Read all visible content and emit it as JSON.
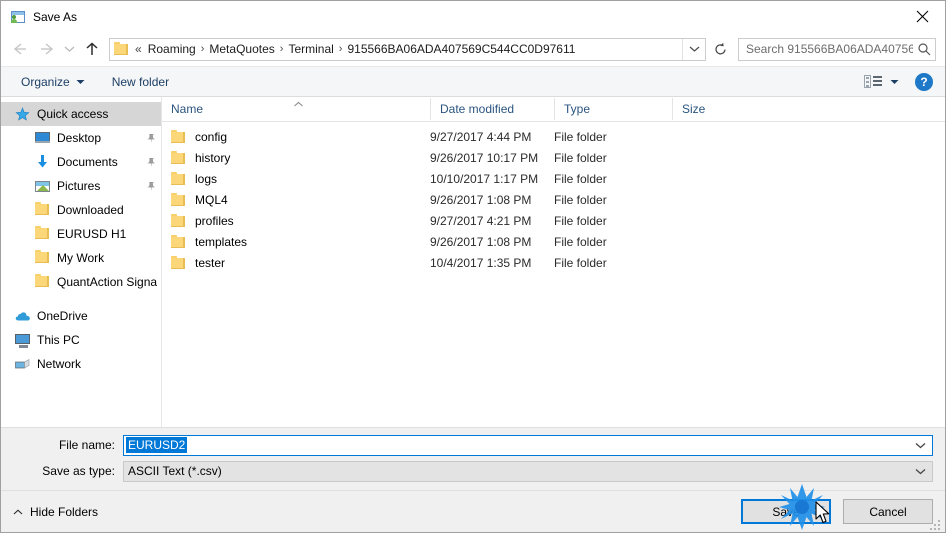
{
  "window": {
    "title": "Save As",
    "icon": "save-as-icon",
    "close_label": "✕"
  },
  "address_bar": {
    "back_icon": "back-arrow-icon",
    "forward_icon": "forward-arrow-icon",
    "recent_icon": "chevron-down-icon",
    "up_icon": "up-arrow-icon",
    "folder_icon": "folder-icon",
    "overflow": "«",
    "crumbs": [
      "Roaming",
      "MetaQuotes",
      "Terminal",
      "915566BA06ADA407569C544CC0D97611"
    ],
    "separator": "›",
    "dropdown_icon": "chevron-down-icon",
    "refresh_icon": "refresh-icon",
    "search_placeholder": "Search 915566BA06ADA40756...",
    "search_icon": "search-icon"
  },
  "toolbar": {
    "organize_label": "Organize",
    "organize_caret": "chevron-down-icon",
    "new_folder_label": "New folder",
    "view_icon": "view-mode-icon",
    "view_caret": "chevron-down-icon",
    "help_label": "?",
    "help_icon": "help-icon"
  },
  "sidebar": {
    "items": [
      {
        "label": "Quick access",
        "icon": "star-icon",
        "indent": "top",
        "selected": true,
        "pinned": false
      },
      {
        "label": "Desktop",
        "icon": "desktop-icon",
        "indent": "0",
        "selected": false,
        "pinned": true
      },
      {
        "label": "Documents",
        "icon": "documents-icon",
        "indent": "0",
        "selected": false,
        "pinned": true
      },
      {
        "label": "Pictures",
        "icon": "pictures-icon",
        "indent": "0",
        "selected": false,
        "pinned": true
      },
      {
        "label": "Downloaded",
        "icon": "folder-icon",
        "indent": "0",
        "selected": false,
        "pinned": false
      },
      {
        "label": "EURUSD H1",
        "icon": "folder-icon",
        "indent": "0",
        "selected": false,
        "pinned": false
      },
      {
        "label": "My Work",
        "icon": "folder-icon",
        "indent": "0",
        "selected": false,
        "pinned": false
      },
      {
        "label": "QuantAction Signal",
        "icon": "folder-icon",
        "indent": "0",
        "selected": false,
        "pinned": false
      },
      {
        "label": "OneDrive",
        "icon": "cloud-icon",
        "indent": "top",
        "selected": false,
        "pinned": false
      },
      {
        "label": "This PC",
        "icon": "pc-icon",
        "indent": "top",
        "selected": false,
        "pinned": false
      },
      {
        "label": "Network",
        "icon": "network-icon",
        "indent": "top",
        "selected": false,
        "pinned": false
      }
    ]
  },
  "file_list": {
    "columns": [
      "Name",
      "Date modified",
      "Type",
      "Size"
    ],
    "sort_indicator": "sort-ascending-icon",
    "rows": [
      {
        "name": "config",
        "date": "9/27/2017 4:44 PM",
        "type": "File folder",
        "size": ""
      },
      {
        "name": "history",
        "date": "9/26/2017 10:17 PM",
        "type": "File folder",
        "size": ""
      },
      {
        "name": "logs",
        "date": "10/10/2017 1:17 PM",
        "type": "File folder",
        "size": ""
      },
      {
        "name": "MQL4",
        "date": "9/26/2017 1:08 PM",
        "type": "File folder",
        "size": ""
      },
      {
        "name": "profiles",
        "date": "9/27/2017 4:21 PM",
        "type": "File folder",
        "size": ""
      },
      {
        "name": "templates",
        "date": "9/26/2017 1:08 PM",
        "type": "File folder",
        "size": ""
      },
      {
        "name": "tester",
        "date": "10/4/2017 1:35 PM",
        "type": "File folder",
        "size": ""
      }
    ]
  },
  "form": {
    "file_name_label": "File name:",
    "file_name_value": "EURUSD2",
    "file_name_caret": "chevron-down-icon",
    "save_as_type_label": "Save as type:",
    "save_as_type_value": "ASCII Text (*.csv)",
    "save_as_type_caret": "chevron-down-icon"
  },
  "footer": {
    "hide_folders_label": "Hide Folders",
    "hide_folders_caret": "chevron-up-icon",
    "save_label": "Save",
    "cancel_label": "Cancel"
  },
  "overlay": {
    "click_marker": "click-burst-marker",
    "cursor": "mouse-cursor"
  },
  "colors": {
    "accent": "#0078d7",
    "folder": "#fcd779",
    "header_text": "#2b5580",
    "selection": "#d6d6d6"
  }
}
